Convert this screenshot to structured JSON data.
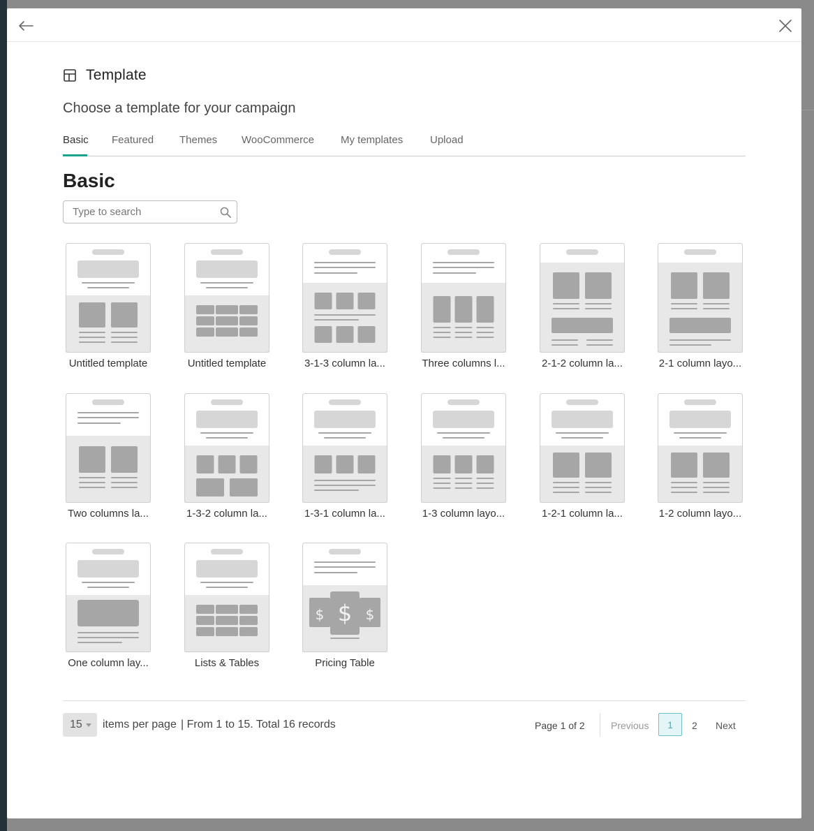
{
  "dialog": {
    "title": "Template",
    "subtitle": "Choose a template for your campaign"
  },
  "tabs": [
    {
      "label": "Basic",
      "active": true
    },
    {
      "label": "Featured"
    },
    {
      "label": "Themes"
    },
    {
      "label": "WooCommerce"
    },
    {
      "label": "My templates"
    },
    {
      "label": "Upload"
    }
  ],
  "section": {
    "title": "Basic",
    "search_placeholder": "Type to search"
  },
  "templates": [
    {
      "label": "Untitled template",
      "icon": "layout-1-2-thumbnail"
    },
    {
      "label": "Untitled template",
      "icon": "layout-1-table-thumbnail"
    },
    {
      "label": "3-1-3 column la...",
      "icon": "layout-3-1-3-thumbnail"
    },
    {
      "label": "Three columns l...",
      "icon": "layout-three-columns-thumbnail"
    },
    {
      "label": "2-1-2 column la...",
      "icon": "layout-2-1-2-thumbnail"
    },
    {
      "label": "2-1 column layo...",
      "icon": "layout-2-1-thumbnail"
    },
    {
      "label": "Two columns la...",
      "icon": "layout-two-columns-thumbnail"
    },
    {
      "label": "1-3-2 column la...",
      "icon": "layout-1-3-2-thumbnail"
    },
    {
      "label": "1-3-1 column la...",
      "icon": "layout-1-3-1-thumbnail"
    },
    {
      "label": "1-3 column layo...",
      "icon": "layout-1-3-thumbnail"
    },
    {
      "label": "1-2-1 column la...",
      "icon": "layout-1-2-1-thumbnail"
    },
    {
      "label": "1-2 column layo...",
      "icon": "layout-1-2-column-thumbnail"
    },
    {
      "label": "One column lay...",
      "icon": "layout-one-column-thumbnail"
    },
    {
      "label": "Lists & Tables",
      "icon": "layout-lists-tables-thumbnail"
    },
    {
      "label": "Pricing Table",
      "icon": "layout-pricing-table-thumbnail",
      "price_symbol": "$"
    }
  ],
  "pagination": {
    "per_page": "15",
    "items_per_page_text": "items per page",
    "records_text": "| From 1 to 15. Total 16 records",
    "page_info": "Page 1 of 2",
    "previous": "Previous",
    "current_page": "1",
    "page_2": "2",
    "next": "Next"
  },
  "colors": {
    "accent": "#1aa38c",
    "current_page_border": "#6fc1c6",
    "current_page_bg": "#e4f5f7",
    "thumb_bg": "#e8e8e8",
    "thumb_block": "#a6a6a6"
  }
}
